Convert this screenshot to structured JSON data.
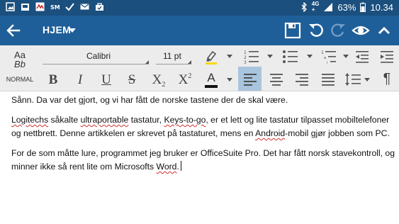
{
  "status_bar": {
    "network": "4G",
    "network_sub": "+",
    "battery": "63%",
    "time": "10.34",
    "icons": [
      "picture-icon",
      "gallery-icon",
      "app-icon",
      "sms-icon",
      "check-icon",
      "email-icon",
      "bag-icon",
      "bluetooth-icon",
      "signal-icon",
      "battery-icon"
    ]
  },
  "app_bar": {
    "title": "HJEM",
    "icons": [
      "back-arrow-icon",
      "save-icon",
      "undo-icon",
      "redo-icon",
      "read-mode-eye-icon",
      "collapse-chevron-icon"
    ]
  },
  "ribbon": {
    "style_preview_top": "Aa",
    "style_preview_bottom": "Bb",
    "style_name": "NORMAL",
    "font_name": "Calibri",
    "font_size": "11 pt",
    "bold_label": "B",
    "italic_label": "I",
    "underline_label": "U",
    "strike_label": "S",
    "subscript_label": "X",
    "subscript_mark": "2",
    "superscript_label": "X",
    "superscript_mark": "2",
    "font_color_label": "A",
    "paragraph_mark": "¶",
    "highlight_color": "#f5d90a",
    "font_color": "#111111",
    "active_alignment": "left"
  },
  "document": {
    "p1": "Sånn. Da var det gjort, og vi har fått de norske tastene der de skal være.",
    "p2": {
      "w1": "Logitechs",
      "t1": " såkalte ",
      "w2": "ultraportable",
      "t2": " tastatur, ",
      "w3": "Keys-to-go",
      "t3": ", er et lett og lite tastatur tilpasset mobiltelefoner og nettbrett. Denne artikkelen er skrevet på tastaturet, mens en ",
      "w4": "Android",
      "t4": "-mobil gjør jobben som PC."
    },
    "p3": {
      "t1": "For de som måtte lure, programmet jeg bruker er OfficeSuite Pro. Det har fått norsk stavekontroll, og minner ikke så rent lite om Microsofts ",
      "w1": "Word",
      "t2": "."
    }
  },
  "colors": {
    "status_bar": "#1a4f7e",
    "app_bar": "#1f5f99",
    "ribbon": "#ececec",
    "active_button": "#a9c4dd",
    "spell_underline": "#d0312d"
  }
}
